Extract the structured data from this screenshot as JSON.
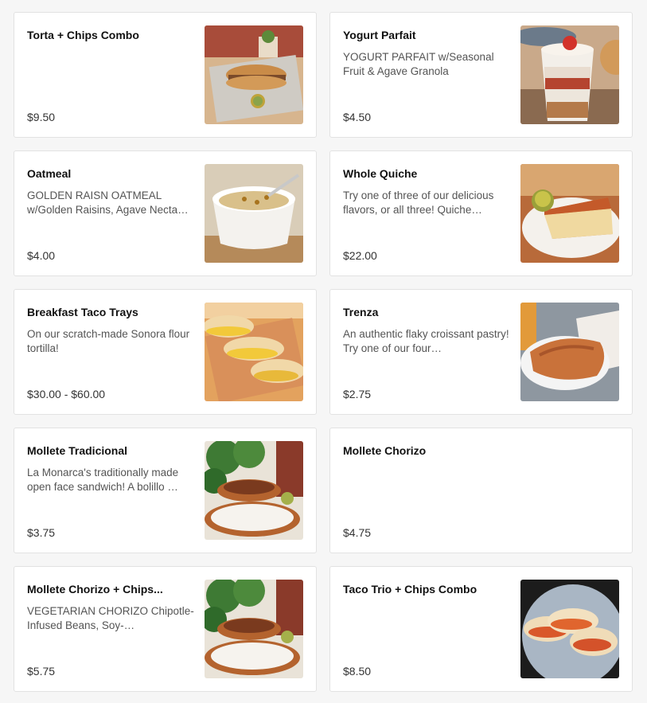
{
  "items": [
    {
      "name": "Torta + Chips Combo",
      "description": "",
      "price": "$9.50",
      "image": "torta-photo"
    },
    {
      "name": "Yogurt Parfait",
      "description": "YOGURT PARFAIT w/Seasonal Fruit & Agave Granola",
      "price": "$4.50",
      "image": "parfait-photo"
    },
    {
      "name": "Oatmeal",
      "description": "GOLDEN RAISN OATMEAL w/Golden Raisins, Agave Necta…",
      "price": "$4.00",
      "image": "oatmeal-photo"
    },
    {
      "name": "Whole Quiche",
      "description": "Try one of three of our delicious flavors, or all three! Quiche…",
      "price": "$22.00",
      "image": "quiche-photo"
    },
    {
      "name": "Breakfast Taco Trays",
      "description": "On our scratch-made Sonora flour tortilla!",
      "price": "$30.00 - $60.00",
      "image": "breakfast-taco-photo"
    },
    {
      "name": "Trenza",
      "description": "An authentic flaky croissant pastry!   Try one of our four…",
      "price": "$2.75",
      "image": "trenza-photo"
    },
    {
      "name": "Mollete Tradicional",
      "description": "La Monarca's traditionally made open face sandwich!   A bolillo …",
      "price": "$3.75",
      "image": "mollete-photo"
    },
    {
      "name": "Mollete Chorizo",
      "description": "",
      "price": "$4.75",
      "image": ""
    },
    {
      "name": "Mollete Chorizo + Chips...",
      "description": "VEGETARIAN CHORIZO Chipotle-Infused Beans, Soy-…",
      "price": "$5.75",
      "image": "mollete-photo"
    },
    {
      "name": "Taco Trio + Chips Combo",
      "description": "",
      "price": "$8.50",
      "image": "taco-trio-photo"
    }
  ]
}
